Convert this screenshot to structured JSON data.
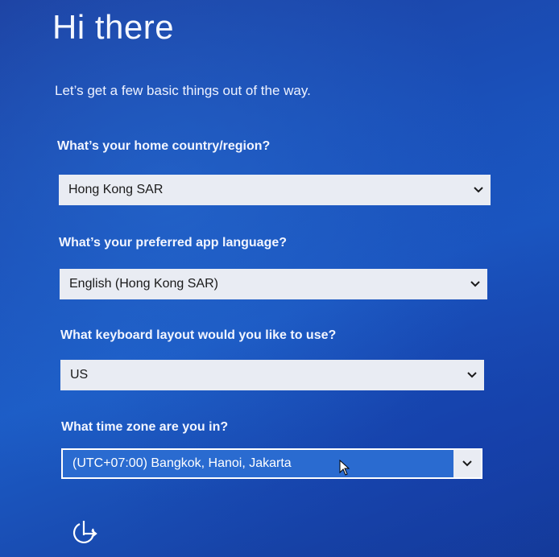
{
  "page": {
    "title": "Hi there",
    "subtitle": "Let’s get a few basic things out of the way."
  },
  "fields": [
    {
      "question": "What’s your home country/region?",
      "value": "Hong Kong SAR"
    },
    {
      "question": "What’s your preferred app language?",
      "value": "English (Hong Kong SAR)"
    },
    {
      "question": "What keyboard layout would you like to use?",
      "value": "US"
    },
    {
      "question": "What time zone are you in?",
      "value": "(UTC+07:00) Bangkok, Hanoi, Jakarta"
    }
  ],
  "icons": {
    "dropdown": "chevron-down-icon",
    "cursor": "mouse-pointer-icon",
    "accessibility": "ease-of-access-icon"
  },
  "colors": {
    "background": "#1c5cc6",
    "field": "#e9ecf3",
    "focused_field": "#2a6bd0"
  }
}
